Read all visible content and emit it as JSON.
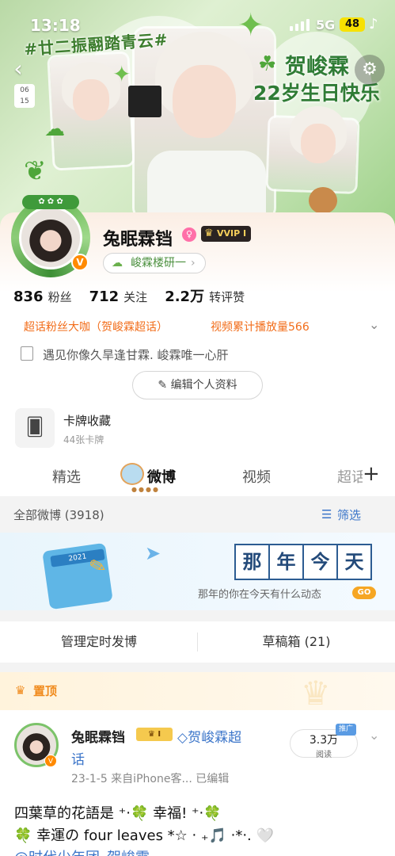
{
  "status_bar": {
    "time": "13:18",
    "network": "5G",
    "battery": "48"
  },
  "banner": {
    "hashtag": "#廿二振翮踏青云#",
    "birthday_line1": "贺峻霖",
    "birthday_line2": "22岁生日快乐",
    "date_tag_1": "06",
    "date_tag_2": "15"
  },
  "profile": {
    "name": "兔眠霖铛",
    "vip_label": "VVIP",
    "vip_level": "I",
    "topic_chip": "峻霖楼研一",
    "stats": [
      {
        "value": "836",
        "label": "粉丝"
      },
      {
        "value": "712",
        "label": "关注"
      },
      {
        "value": "2.2万",
        "label": "转评赞"
      }
    ],
    "tag_left": "超话粉丝大咖（贺峻霖超话）",
    "tag_right": "视频累计播放量566",
    "bio": "遇见你像久旱逢甘霖. 峻霖唯一心肝",
    "edit_button": "编辑个人资料",
    "cards_title": "卡牌收藏",
    "cards_count": "44张卡牌"
  },
  "tabs": [
    {
      "label": "精选"
    },
    {
      "label": "微博"
    },
    {
      "label": "视频"
    },
    {
      "label": "超话"
    }
  ],
  "feed_header": {
    "all_label": "全部微博 (3918)",
    "filter_label": "筛选"
  },
  "memory": {
    "chars": [
      "那",
      "年",
      "今",
      "天"
    ],
    "subtitle": "那年的你在今天有什么动态",
    "go": "GO",
    "calendar_year": "2021"
  },
  "actions": {
    "scheduled": "管理定时发博",
    "drafts": "草稿箱 (21)"
  },
  "pinned": {
    "label": "置顶"
  },
  "post": {
    "author": "兔眠霖铛",
    "vip_level": "I",
    "topic_line1": "贺峻霖超",
    "topic_line2": "话",
    "meta": "23-1-5  来自iPhone客...  已编辑",
    "read_count": "3.3万",
    "read_label": "阅读",
    "promo": "推广",
    "line1": "四葉草的花語是 ⁺‧🍀 幸福! ⁺‧🍀",
    "line2": "🍀 幸運の four leaves *☆ ‧ ₊🎵 ‧*‧. 🤍",
    "line3": "@时代少年团_贺峻霖"
  },
  "colors": {
    "accent_orange": "#f26d1a",
    "link_blue": "#3b75c9",
    "banner_green": "#9fd28a"
  }
}
